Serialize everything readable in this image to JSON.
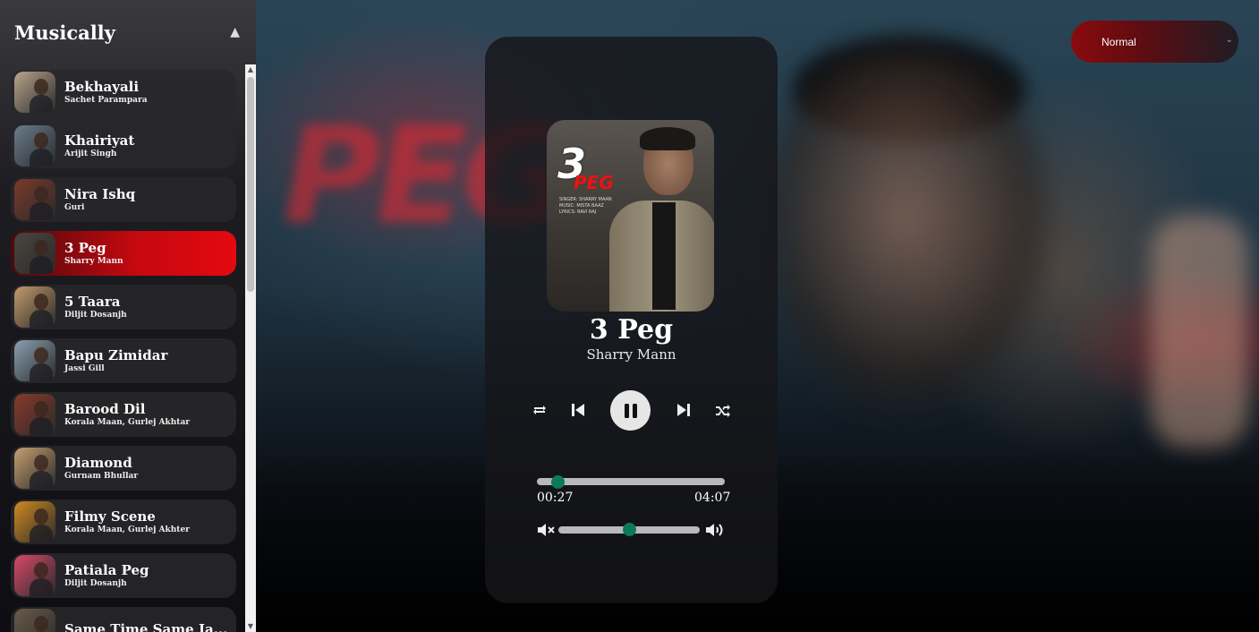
{
  "app": {
    "brand": "Musically"
  },
  "sidebar": {
    "songs": [
      {
        "title": "Bekhayali",
        "artist": "Sachet Parampara",
        "thumb_color": "#b9a58c"
      },
      {
        "title": "Khairiyat",
        "artist": "Arijit Singh",
        "thumb_color": "#6b7c8c"
      },
      {
        "title": "Nira Ishq",
        "artist": "Guri",
        "thumb_color": "#7a3a2a"
      },
      {
        "title": "3 Peg",
        "artist": "Sharry Mann",
        "thumb_color": "#4a4540",
        "active": true
      },
      {
        "title": "5 Taara",
        "artist": "Diljit Dosanjh",
        "thumb_color": "#c39a6a"
      },
      {
        "title": "Bapu Zimidar",
        "artist": "Jassi Gill",
        "thumb_color": "#8aa0b0"
      },
      {
        "title": "Barood Dil",
        "artist": "Korala Maan, Gurlej Akhtar",
        "thumb_color": "#8a3a2a"
      },
      {
        "title": "Diamond",
        "artist": "Gurnam Bhullar",
        "thumb_color": "#c8a070"
      },
      {
        "title": "Filmy Scene",
        "artist": "Korala Maan, Gurlej Akhter",
        "thumb_color": "#d08a20"
      },
      {
        "title": "Patiala Peg",
        "artist": "Diljit Dosanjh",
        "thumb_color": "#d84a6a"
      },
      {
        "title": "Same Time Same Ja...",
        "artist": "",
        "thumb_color": "#6a5a4a"
      }
    ]
  },
  "player": {
    "cover_title": "3",
    "cover_word": "PEG",
    "cover_credits": "SINGER: SHARRY MAAN\nMUSIC: MISTA BAAZ\nLYRICS: RAVI RAJ",
    "title": "3 Peg",
    "artist": "Sharry Mann",
    "current_time": "00:27",
    "duration": "04:07",
    "progress_fraction": 0.11,
    "volume_fraction": 0.5,
    "accent_color": "#0c7a55"
  },
  "mode_select": {
    "value": "Normal"
  },
  "icons": [
    "repeat-icon",
    "previous-icon",
    "pause-icon",
    "next-icon",
    "shuffle-icon",
    "mute-icon",
    "volume-icon",
    "chevron-up-icon",
    "chevron-down-icon"
  ]
}
